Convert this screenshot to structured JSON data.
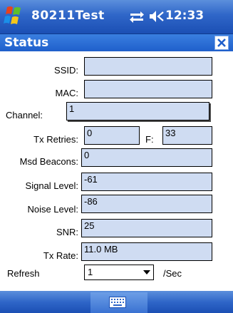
{
  "taskbar": {
    "app_title": "80211Test",
    "clock": "12:33",
    "icons": [
      "windows-start-icon",
      "connectivity-icon",
      "volume-icon"
    ]
  },
  "header": {
    "title": "Status",
    "close_label": "✕"
  },
  "fields": {
    "ssid": {
      "label": "SSID:",
      "value": ""
    },
    "mac": {
      "label": "MAC:",
      "value": ""
    },
    "channel": {
      "label": "Channel:",
      "value": "1"
    },
    "tx_retries": {
      "label": "Tx Retries:",
      "value": "0"
    },
    "f": {
      "label": "F:",
      "value": "33"
    },
    "msd_beacons": {
      "label": "Msd Beacons:",
      "value": "0"
    },
    "signal_level": {
      "label": "Signal Level:",
      "value": "-61"
    },
    "noise_level": {
      "label": "Noise Level:",
      "value": "-86"
    },
    "snr": {
      "label": "SNR:",
      "value": "25"
    },
    "tx_rate": {
      "label": "Tx Rate:",
      "value": "11.0 MB"
    }
  },
  "refresh": {
    "label": "Refresh",
    "selected": "1",
    "unit": "/Sec"
  },
  "bottom": {
    "icons": [
      "keyboard-icon"
    ]
  }
}
